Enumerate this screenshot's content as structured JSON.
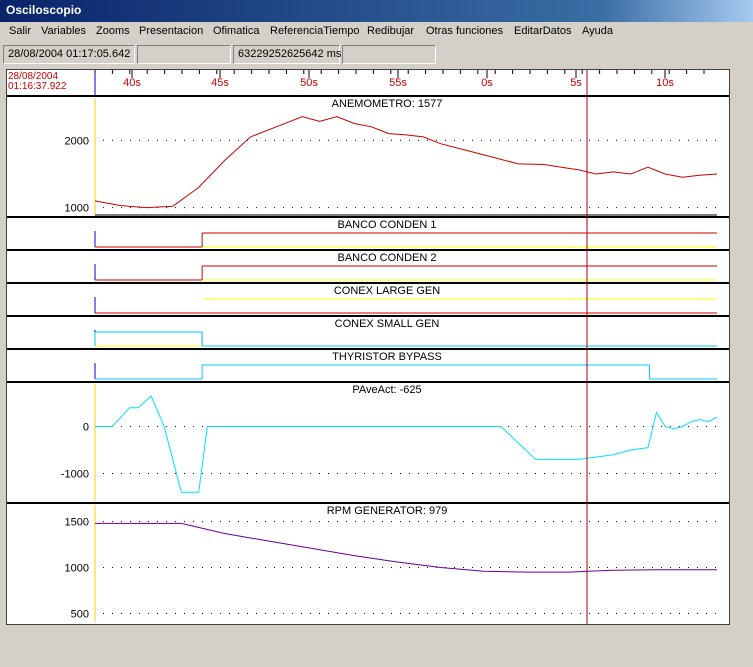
{
  "window": {
    "title": "Osciloscopio"
  },
  "menu": [
    "Salir",
    "Variables",
    "Zooms",
    "Presentacion",
    "Ofimatica",
    "ReferenciaTiempo",
    "Redibujar",
    "Otras funciones",
    "EditarDatos",
    "Ayuda"
  ],
  "status": {
    "datetime": "28/08/2004 01:17:05.642",
    "blank1": "",
    "ms_value": "63229252625642 ms",
    "blank2": ""
  },
  "time_axis": {
    "start_date": "28/08/2004",
    "start_time": "01:16:37.922",
    "ticks": [
      "40s",
      "45s",
      "50s",
      "55s",
      "0s",
      "5s",
      "10s"
    ]
  },
  "colors": {
    "red": "#cc0000",
    "blue": "#0000cc",
    "yellow": "#ffff00",
    "cyan": "#00c8ff",
    "purple": "#660099",
    "cursor": "#aa0000"
  },
  "chart_data": [
    {
      "type": "line",
      "title": "ANEMOMETRO: 1577",
      "y_ticks": [
        "2000",
        "1000"
      ],
      "x": [
        0,
        3,
        6,
        9,
        12,
        15,
        18,
        21,
        24,
        26,
        28,
        30,
        32,
        34,
        36,
        38,
        40,
        43,
        46,
        49,
        52,
        54,
        56,
        58,
        60,
        62,
        64,
        66,
        68,
        70,
        72
      ],
      "values": [
        1100,
        1030,
        1000,
        1020,
        1300,
        1700,
        2050,
        2200,
        2350,
        2280,
        2350,
        2250,
        2200,
        2100,
        2080,
        2050,
        1950,
        1850,
        1750,
        1650,
        1640,
        1600,
        1560,
        1500,
        1530,
        1500,
        1600,
        1500,
        1450,
        1480,
        1500
      ],
      "ylim": [
        950,
        2450
      ],
      "color": "#cc0000"
    },
    {
      "type": "step",
      "title": "BANCO CONDEN 1",
      "segments": [
        {
          "color": "#cc0000",
          "from": 0,
          "to": 12.4,
          "level": "low"
        },
        {
          "color": "#cc0000",
          "from": 12.4,
          "to": 72,
          "level": "high"
        },
        {
          "color": "#ffff00",
          "from": 12.4,
          "to": 72,
          "level": "low"
        }
      ]
    },
    {
      "type": "step",
      "title": "BANCO CONDEN 2",
      "segments": [
        {
          "color": "#cc0000",
          "from": 0,
          "to": 12.4,
          "level": "low"
        },
        {
          "color": "#cc0000",
          "from": 12.4,
          "to": 72,
          "level": "high"
        },
        {
          "color": "#ffff00",
          "from": 12.4,
          "to": 72,
          "level": "low"
        }
      ]
    },
    {
      "type": "step",
      "title": "CONEX LARGE GEN",
      "segments": [
        {
          "color": "#cc0000",
          "from": 0,
          "to": 12.5,
          "level": "low"
        },
        {
          "color": "#cc0000",
          "from": 12.5,
          "to": 72,
          "level": "low"
        },
        {
          "color": "#ffff00",
          "from": 12.5,
          "to": 72,
          "level": "high"
        }
      ]
    },
    {
      "type": "step",
      "title": "CONEX SMALL GEN",
      "segments": [
        {
          "color": "#00c8ff",
          "from": 0,
          "to": 12.4,
          "level": "high"
        },
        {
          "color": "#00c8ff",
          "from": 12.4,
          "to": 72,
          "level": "low"
        },
        {
          "color": "#ffff00",
          "from": 0,
          "to": 12.4,
          "level": "low"
        }
      ]
    },
    {
      "type": "step",
      "title": "THYRISTOR BYPASS",
      "segments": [
        {
          "color": "#00c8ff",
          "from": 0,
          "to": 12.4,
          "level": "low"
        },
        {
          "color": "#00c8ff",
          "from": 12.4,
          "to": 64.2,
          "level": "high"
        },
        {
          "color": "#00c8ff",
          "from": 64.2,
          "to": 72,
          "level": "low"
        }
      ]
    },
    {
      "type": "line",
      "title": "PAveAct: -625",
      "y_ticks": [
        "0",
        "-1000"
      ],
      "x": [
        0,
        2,
        4,
        5,
        6.5,
        8,
        10,
        12,
        13,
        15,
        17,
        24,
        34,
        45,
        47,
        51,
        56,
        60,
        62,
        64,
        65,
        66,
        67,
        68,
        69,
        70,
        71,
        72
      ],
      "values": [
        0,
        0,
        400,
        400,
        650,
        0,
        -1400,
        -1400,
        0,
        0,
        0,
        0,
        0,
        0,
        0,
        -700,
        -700,
        -600,
        -500,
        -450,
        300,
        0,
        -50,
        0,
        100,
        150,
        100,
        200
      ],
      "ylim": [
        -1500,
        650
      ],
      "color": "#00e0ff"
    },
    {
      "type": "line",
      "title": "RPM GENERATOR: 979",
      "y_ticks": [
        "1500",
        "1000",
        "500"
      ],
      "x": [
        0,
        5,
        10,
        15,
        20,
        25,
        30,
        35,
        40,
        45,
        50,
        55,
        57,
        60,
        65,
        70,
        72
      ],
      "values": [
        1480,
        1480,
        1480,
        1370,
        1290,
        1210,
        1130,
        1060,
        1000,
        960,
        950,
        950,
        960,
        970,
        975,
        975,
        975
      ],
      "ylim": [
        450,
        1550
      ],
      "color": "#660099"
    }
  ]
}
